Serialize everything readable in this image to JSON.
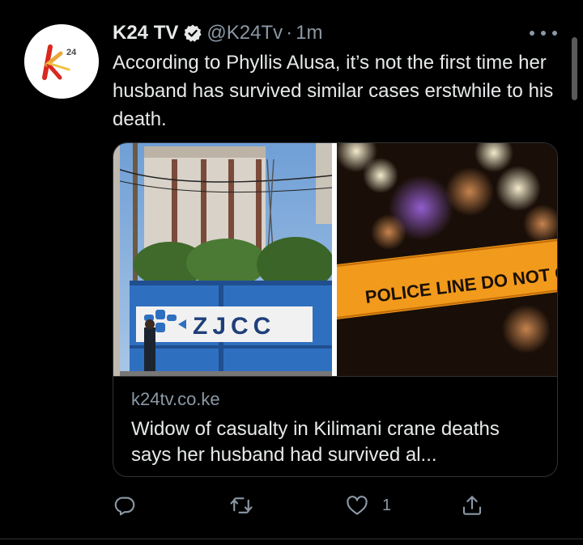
{
  "tweet": {
    "display_name": "K24 TV",
    "handle": "@K24Tv",
    "separator": "·",
    "time": "1m",
    "verified_icon": "verified-badge-icon",
    "text": "According to Phyllis Alusa, it’s not the first time her husband has survived similar cases erstwhile to his death."
  },
  "avatar": {
    "logo_letter": "K",
    "logo_number": "24"
  },
  "card": {
    "domain": "k24tv.co.ke",
    "title": "Widow of casualty in Kilimani crane deaths says her husband had survived al...",
    "left_image": {
      "sign_text": "ZJCC"
    },
    "right_image": {
      "tape_text": "POLICE LINE DO NOT CROSS"
    }
  },
  "actions": {
    "reply_icon": "reply-icon",
    "retweet_icon": "retweet-icon",
    "like_icon": "heart-icon",
    "like_count": "1",
    "share_icon": "share-icon"
  },
  "colors": {
    "background": "#000000",
    "text": "#e7e9ea",
    "muted": "#8b98a5",
    "border": "#2f3336"
  }
}
